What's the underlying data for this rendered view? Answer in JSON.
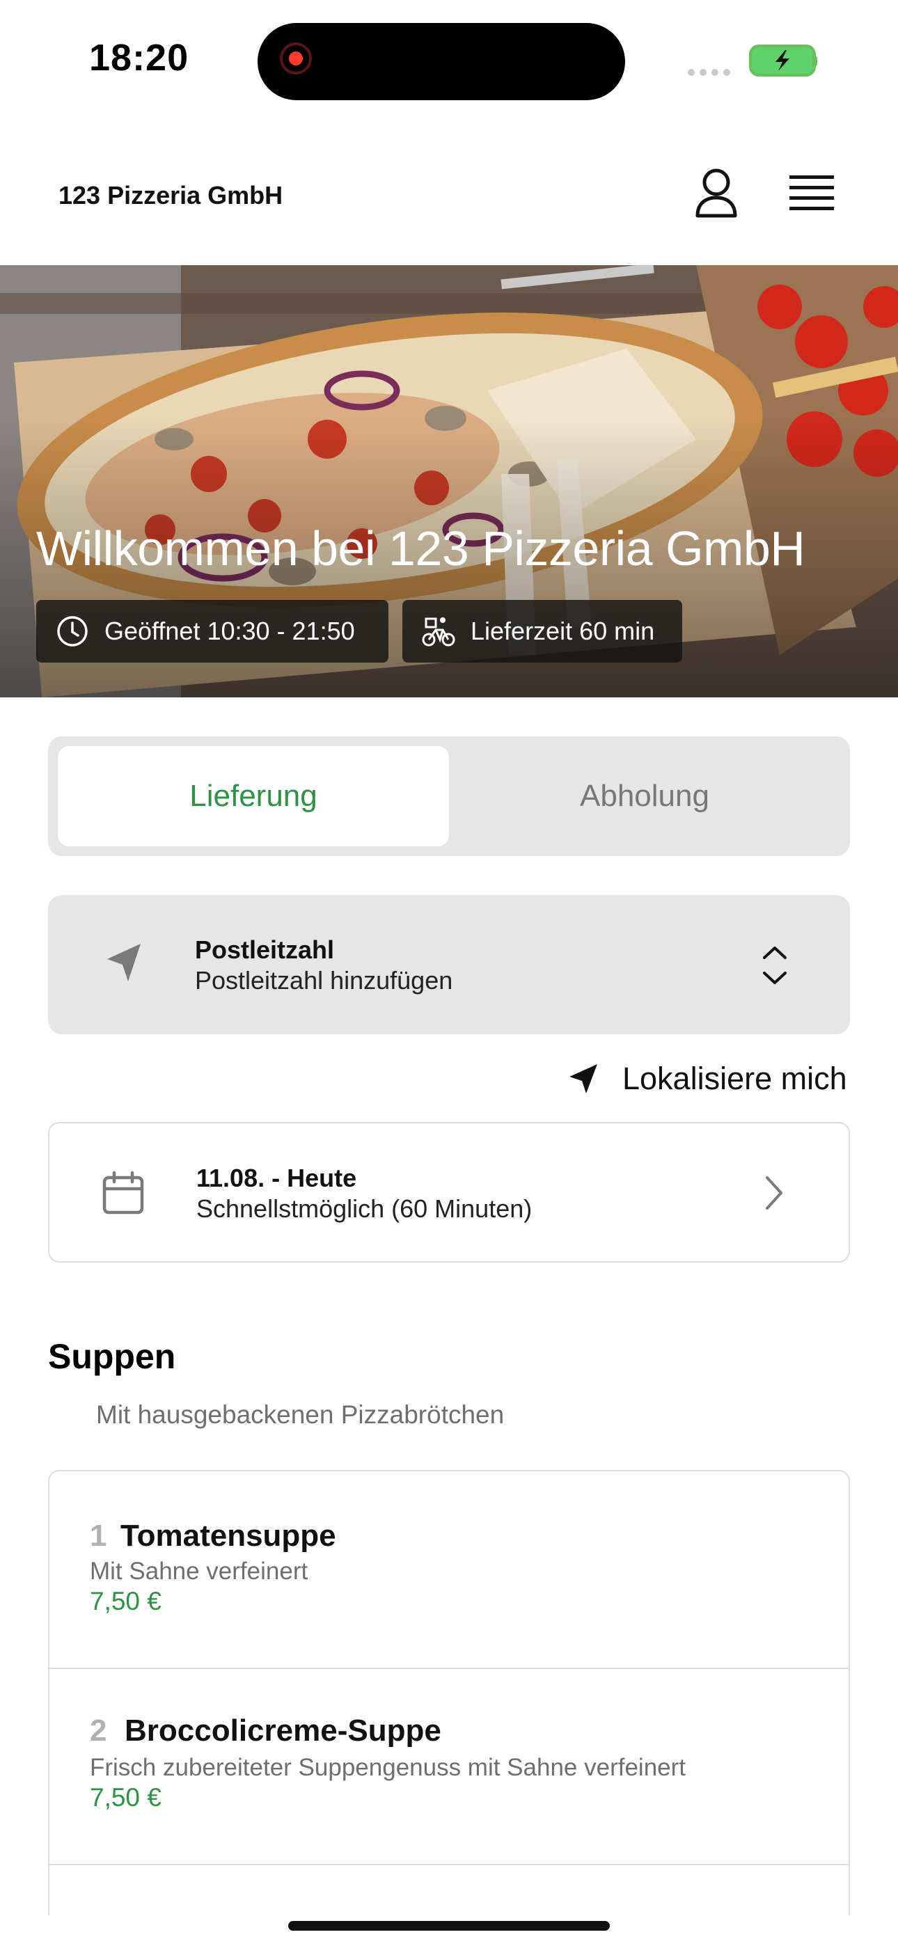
{
  "status_bar": {
    "time": "18:20"
  },
  "header": {
    "brand": "123 Pizzeria GmbH",
    "icons": [
      "user-icon",
      "menu-icon"
    ]
  },
  "hero": {
    "title": "Willkommen bei 123 Pizzeria GmbH",
    "open_hours": "Geöffnet 10:30 - 21:50",
    "delivery_time": "Lieferzeit 60 min"
  },
  "order_mode": {
    "tabs": [
      "Lieferung",
      "Abholung"
    ],
    "selected": "Lieferung"
  },
  "zip": {
    "label": "Postleitzahl",
    "placeholder": "Postleitzahl hinzufügen"
  },
  "locate": {
    "label": "Lokalisiere mich"
  },
  "schedule": {
    "date": "11.08. - Heute",
    "time": "Schnellstmöglich (60 Minuten)"
  },
  "section": {
    "title": "Suppen",
    "subtitle": "Mit hausgebackenen Pizzabrötchen",
    "items": [
      {
        "number": "1",
        "name": "Tomatensuppe",
        "description": "Mit Sahne verfeinert",
        "price": "7,50 €"
      },
      {
        "number": "2",
        "name": "Broccolicreme-Suppe",
        "description": "Frisch zubereiteter Suppengenuss mit Sahne verfeinert",
        "price": "7,50 €"
      }
    ]
  },
  "colors": {
    "accent_green": "#2e9244",
    "panel_gray": "#e6e6e6"
  }
}
